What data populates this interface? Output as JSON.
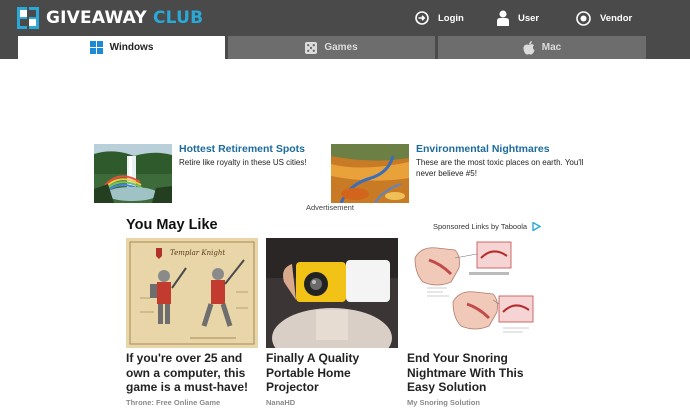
{
  "logo": {
    "word1": "GIVEAWAY",
    "word2": "CLUB"
  },
  "top_links": [
    {
      "label": "Login",
      "icon": "login-icon"
    },
    {
      "label": "User",
      "icon": "user-icon"
    },
    {
      "label": "Vendor",
      "icon": "vendor-icon"
    }
  ],
  "tabs": [
    {
      "label": "Windows",
      "icon": "windows-icon",
      "active": true
    },
    {
      "label": "Games",
      "icon": "dice-icon",
      "active": false
    },
    {
      "label": "Mac",
      "icon": "apple-icon",
      "active": false
    }
  ],
  "ads": [
    {
      "title": "Hottest Retirement Spots",
      "desc": "Retire like royalty in these US cities!"
    },
    {
      "title": "Environmental Nightmares",
      "desc": "These are the most toxic places on earth. You'll never believe #5!"
    }
  ],
  "ad_label": "Advertisement",
  "you_may_like": {
    "heading": "You May Like",
    "sponsored": "Sponsored Links by Taboola"
  },
  "knight_image_caption": "Templar Knight",
  "cards": [
    {
      "headline": "If you're over 25 and own a computer, this game is a must-have!",
      "source": "Throne: Free Online Game"
    },
    {
      "headline": "Finally A Quality Portable Home Projector",
      "source": "NanaHD"
    },
    {
      "headline": "End Your Snoring Nightmare With This Easy Solution",
      "source": "My Snoring Solution"
    }
  ],
  "colors": {
    "header_bg": "#4a4a4a",
    "tab_inactive": "#6d6d6d",
    "brand_blue": "#2aa8d8",
    "link_blue": "#1c6b9c"
  }
}
